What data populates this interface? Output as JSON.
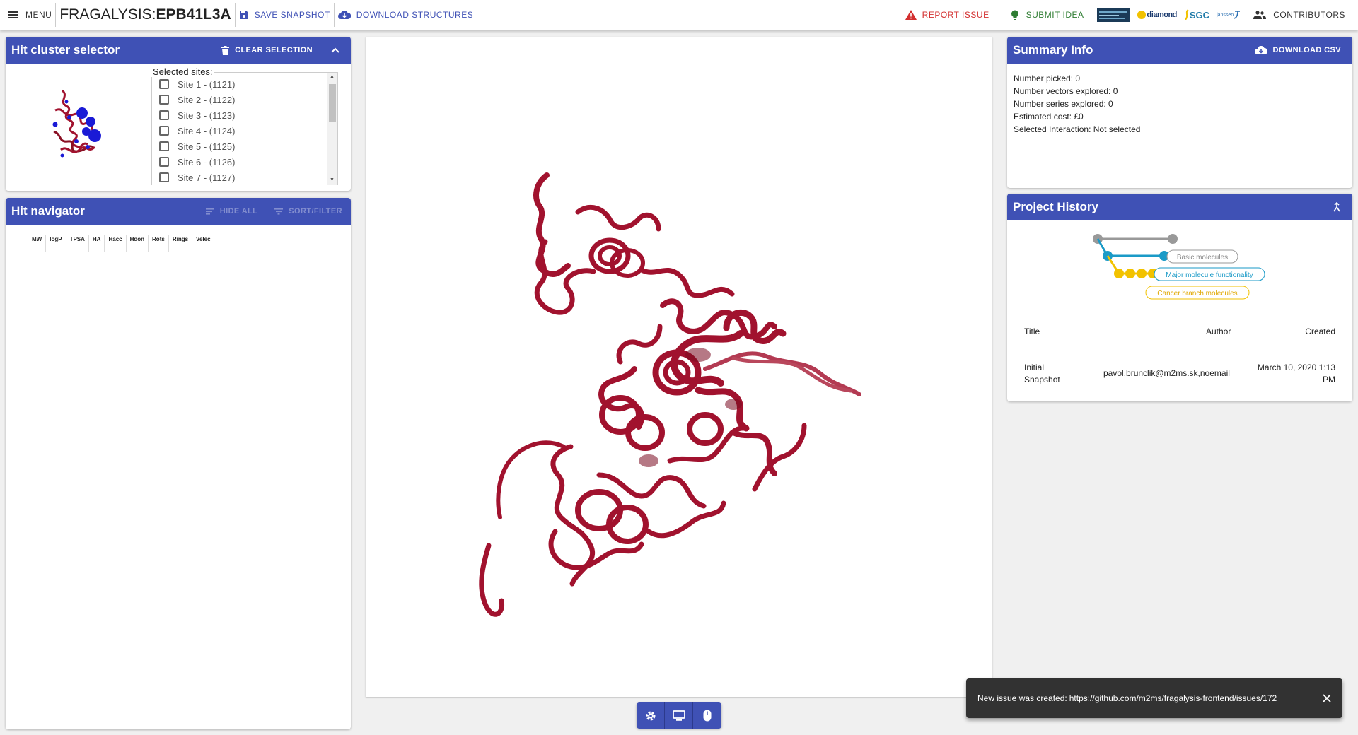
{
  "topbar": {
    "menu_label": "MENU",
    "app_name": "FRAGALYSIS: ",
    "target": "EPB41L3A",
    "save_snapshot": "SAVE SNAPSHOT",
    "download_structures": "DOWNLOAD STRUCTURES",
    "report_issue": "REPORT ISSUE",
    "submit_idea": "SUBMIT IDEA",
    "logo_diamond": "diamond",
    "logo_sgc": "SGC",
    "logo_janssen": "janssen",
    "contributors": "CONTRIBUTORS"
  },
  "cluster": {
    "title": "Hit cluster selector",
    "clear_selection": "CLEAR SELECTION",
    "selected_label": "Selected sites:",
    "sites": [
      "Site 1 - (1121)",
      "Site 2 - (1122)",
      "Site 3 - (1123)",
      "Site 4 - (1124)",
      "Site 5 - (1125)",
      "Site 6 - (1126)",
      "Site 7 - (1127)"
    ]
  },
  "navigator": {
    "title": "Hit navigator",
    "hide_all": "HIDE ALL",
    "sort_filter": "SORT/FILTER",
    "columns": [
      "MW",
      "logP",
      "TPSA",
      "HA",
      "Hacc",
      "Hdon",
      "Rots",
      "Rings",
      "Velec"
    ]
  },
  "summary": {
    "title": "Summary Info",
    "download_csv": "DOWNLOAD CSV",
    "lines": [
      "Number picked: 0",
      "Number vectors explored: 0",
      "Number series explored: 0",
      "Estimated cost: £0",
      "Selected Interaction: Not selected"
    ]
  },
  "history": {
    "title": "Project History",
    "branches": [
      "Basic molecules",
      "Major molecule functionality",
      "Cancer branch molecules"
    ],
    "col_title": "Title",
    "col_author": "Author",
    "col_created": "Created",
    "row_title_1": "Initial",
    "row_title_2": "Snapshot",
    "row_author": "pavol.brunclik@m2ms.sk,noemail",
    "row_created_1": "March 10, 2020 1:13",
    "row_created_2": "PM"
  },
  "snackbar": {
    "message": "New issue was created:",
    "link": "https://github.com/m2ms/fragalysis-frontend/issues/172"
  },
  "colors": {
    "primary": "#3f51b5",
    "protein": "#a1122e",
    "history_blue": "#1a9ac7",
    "history_yellow": "#f2c200",
    "history_gray": "#999999"
  }
}
